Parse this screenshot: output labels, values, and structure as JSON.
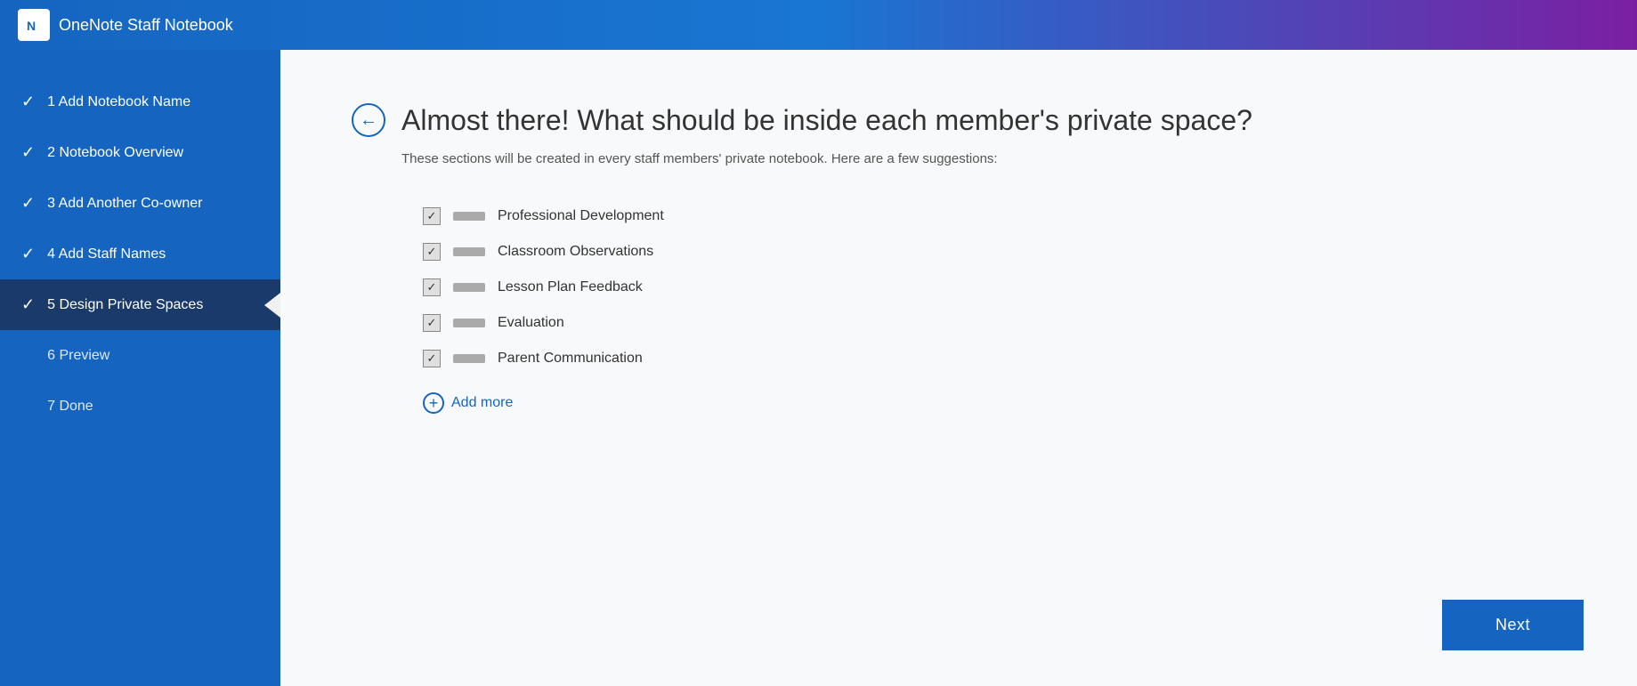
{
  "header": {
    "app_name": "OneNote Staff Notebook",
    "logo_text": "N"
  },
  "sidebar": {
    "items": [
      {
        "id": "step1",
        "number": "1",
        "label": "Add Notebook Name",
        "completed": true,
        "active": false
      },
      {
        "id": "step2",
        "number": "2",
        "label": "Notebook Overview",
        "completed": true,
        "active": false
      },
      {
        "id": "step3",
        "number": "3",
        "label": "Add Another Co-owner",
        "completed": true,
        "active": false
      },
      {
        "id": "step4",
        "number": "4",
        "label": "Add Staff Names",
        "completed": true,
        "active": false
      },
      {
        "id": "step5",
        "number": "5",
        "label": "Design Private Spaces",
        "completed": true,
        "active": true
      },
      {
        "id": "step6",
        "number": "6",
        "label": "Preview",
        "completed": false,
        "active": false
      },
      {
        "id": "step7",
        "number": "7",
        "label": "Done",
        "completed": false,
        "active": false
      }
    ]
  },
  "content": {
    "back_button_label": "←",
    "page_title": "Almost there! What should be inside each member's private space?",
    "page_subtitle": "These sections will be created in every staff members' private notebook. Here are a few suggestions:",
    "checklist_items": [
      {
        "id": "item1",
        "label": "Professional Development",
        "checked": true
      },
      {
        "id": "item2",
        "label": "Classroom Observations",
        "checked": true
      },
      {
        "id": "item3",
        "label": "Lesson Plan Feedback",
        "checked": true
      },
      {
        "id": "item4",
        "label": "Evaluation",
        "checked": true
      },
      {
        "id": "item5",
        "label": "Parent Communication",
        "checked": true
      }
    ],
    "add_more_label": "Add more",
    "next_button_label": "Next"
  }
}
